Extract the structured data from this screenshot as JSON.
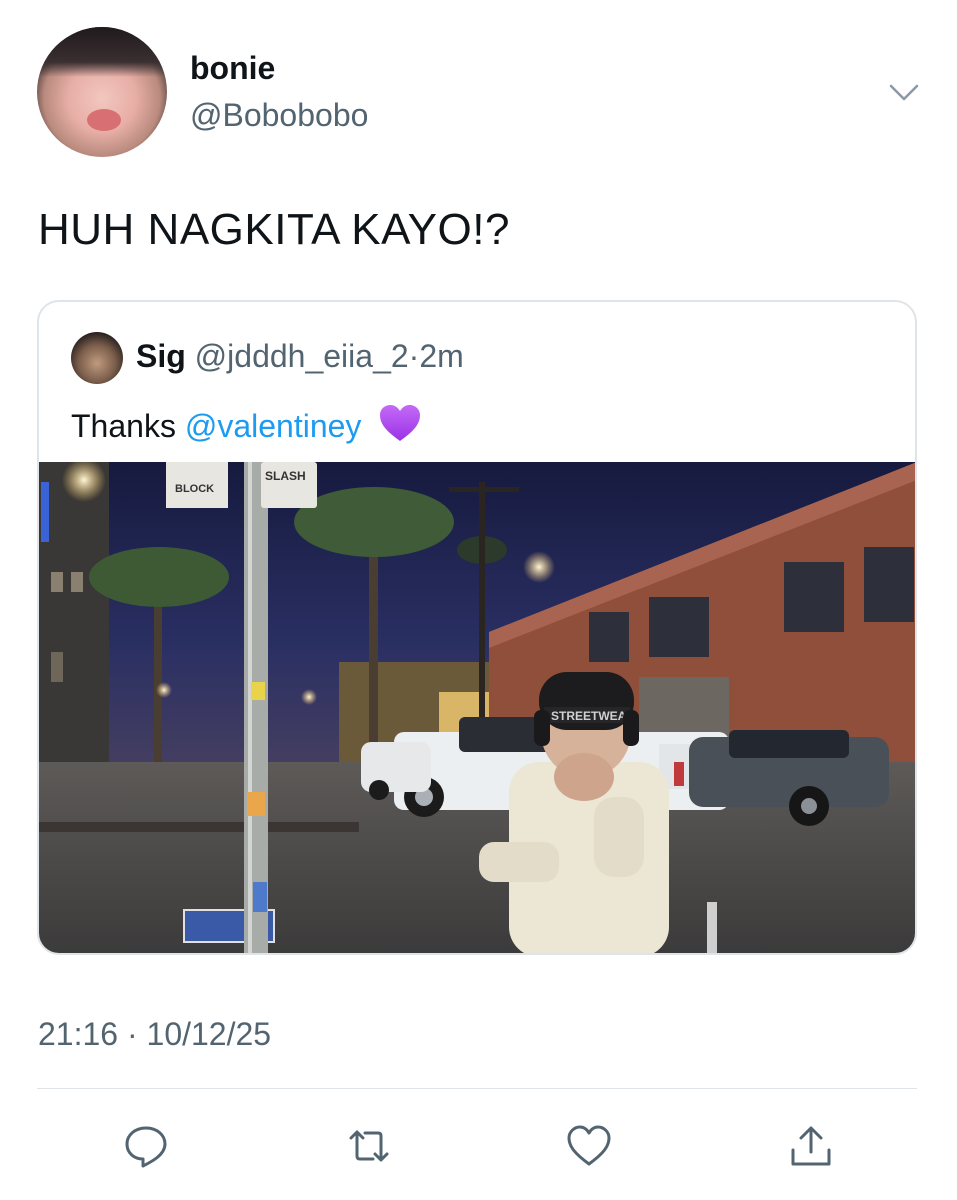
{
  "tweet": {
    "author": {
      "display_name": "bonie",
      "handle": "@Bobobobo"
    },
    "text": "HUH NAGKITA KAYO!?",
    "timestamp": "21:16 · 10/12/25"
  },
  "quote": {
    "author_name": "Sig",
    "author_handle": "@jdddh_eiia_2",
    "separator": "·",
    "age": "2m",
    "text_prefix": "Thanks",
    "mention": "@valentiney",
    "emoji": "purple-heart"
  },
  "photo_signs": {
    "left_sign": "BLOCK",
    "right_sign": "SLASH",
    "beanie_text": "STREETWEAR"
  },
  "actions": [
    {
      "name": "reply",
      "icon": "speech-bubble-icon"
    },
    {
      "name": "retweet",
      "icon": "retweet-arrows-icon"
    },
    {
      "name": "like",
      "icon": "heart-outline-icon"
    },
    {
      "name": "share",
      "icon": "share-upload-icon"
    }
  ],
  "colors": {
    "link_blue": "#1d9bf0",
    "secondary_text": "#536471",
    "divider": "#dfe4e8",
    "emoji_purple": "#b14cf0"
  }
}
